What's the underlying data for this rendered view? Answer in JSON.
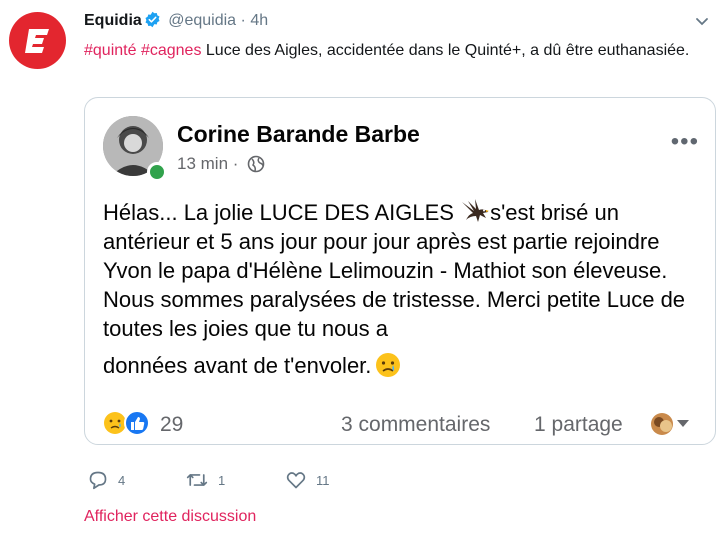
{
  "tweet": {
    "author_name": "Equidia",
    "handle": "@equidia",
    "separator": "·",
    "time": "4h",
    "hashtags": [
      "#quinté",
      "#cagnes"
    ],
    "text": "Luce des Aigles, accidentée dans le Quinté+, a dû être euthanasiée.",
    "brand_color": "#e3262f",
    "accent_color": "#e0245e"
  },
  "fb_post": {
    "author": "Corine Barande Barbe",
    "time": "13 min",
    "separator": "·",
    "privacy_icon": "globe-icon",
    "more_icon": "more-options-icon",
    "more_label": "•••",
    "body_part1": "Hélas... La jolie LUCE DES AIGLES ",
    "body_part2": "s'est brisé un antérieur et 5 ans jour pour jour après est partie rejoindre Yvon le papa d'Hélène Lelimouzin - Mathiot son éleveuse. Nous sommes paralysées de tristesse. Merci petite Luce de toutes les joies que tu nous a",
    "body_last": "données avant de t'envoler.",
    "reaction_icons": [
      "sad-face-icon",
      "like-icon"
    ],
    "reaction_count": "29",
    "comments": "3 commentaires",
    "shares": "1 partage"
  },
  "actions": {
    "reply_count": "4",
    "retweet_count": "1",
    "like_count": "11"
  },
  "show_discussion": "Afficher cette discussion"
}
